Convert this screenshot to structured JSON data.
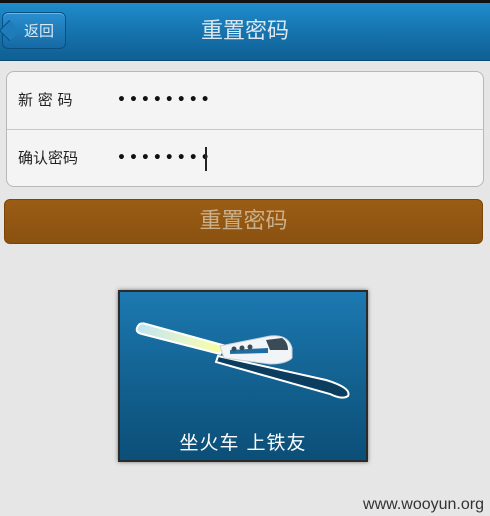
{
  "navbar": {
    "back_label": "返回",
    "title": "重置密码"
  },
  "form": {
    "new_password": {
      "label": "新 密 码",
      "value": "••••••••"
    },
    "confirm_password": {
      "label": "确认密码",
      "value": "••••••••"
    }
  },
  "reset_button": {
    "label": "重置密码"
  },
  "splash": {
    "slogan": "坐火车  上铁友"
  },
  "watermark": "www.wooyun.org",
  "colors": {
    "navbar": "#1674ae",
    "button": "#8a5110",
    "splash_bg": "#12608f"
  }
}
